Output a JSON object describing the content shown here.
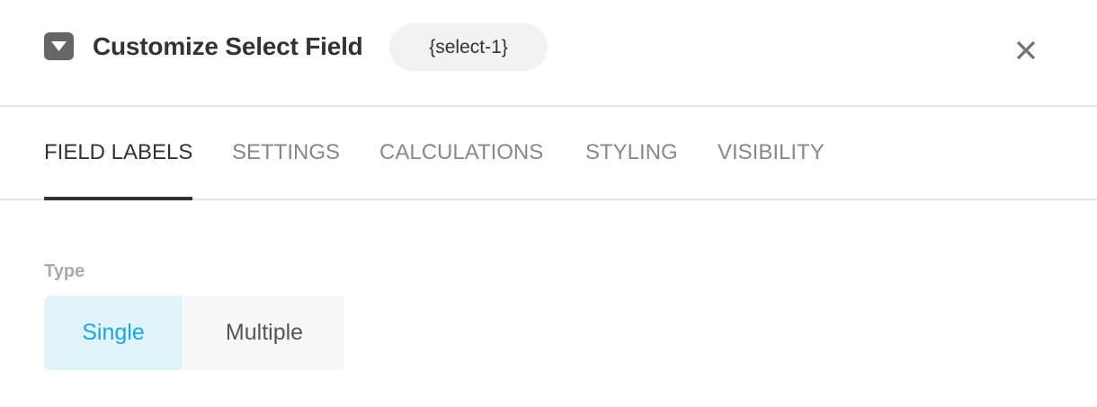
{
  "header": {
    "icon": "dropdown-select-icon",
    "title": "Customize Select Field",
    "tag": "{select-1}",
    "close_icon": "close-icon"
  },
  "tabs": [
    {
      "label": "FIELD LABELS",
      "active": true
    },
    {
      "label": "SETTINGS",
      "active": false
    },
    {
      "label": "CALCULATIONS",
      "active": false
    },
    {
      "label": "STYLING",
      "active": false
    },
    {
      "label": "VISIBILITY",
      "active": false
    }
  ],
  "type_field": {
    "label": "Type",
    "options": [
      {
        "label": "Single",
        "selected": true
      },
      {
        "label": "Multiple",
        "selected": false
      }
    ]
  },
  "colors": {
    "accent": "#17a8e3",
    "selected_bg": "#e1f3fb",
    "text_dark": "#333333",
    "text_muted": "#888888"
  }
}
